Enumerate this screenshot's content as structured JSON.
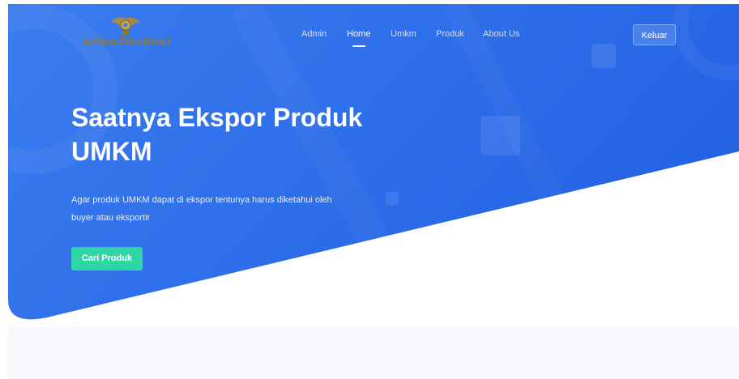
{
  "brand": {
    "name": "ArthurDirektori"
  },
  "nav": {
    "items": [
      {
        "label": "Admin"
      },
      {
        "label": "Home"
      },
      {
        "label": "Umkm"
      },
      {
        "label": "Produk"
      },
      {
        "label": "About Us"
      }
    ],
    "active_item": "Home",
    "logout_label": "Keluar"
  },
  "hero": {
    "title_line1": "Saatnya Ekspor Produk",
    "title_line2": "UMKM",
    "subtitle_line1": "Agar produk UMKM dapat di ekspor tentunya harus diketahui oleh",
    "subtitle_line2": "buyer atau eksportir",
    "cta_label": "Cari Produk"
  },
  "colors": {
    "hero_start": "#3a7cf0",
    "hero_end": "#2463e4",
    "cta": "#2ed6a6",
    "logo_gold": "#8c7a3e",
    "bottom_strip": "#f6f8fb"
  },
  "icons": {
    "logo_emblem": "winged-crest-icon"
  }
}
